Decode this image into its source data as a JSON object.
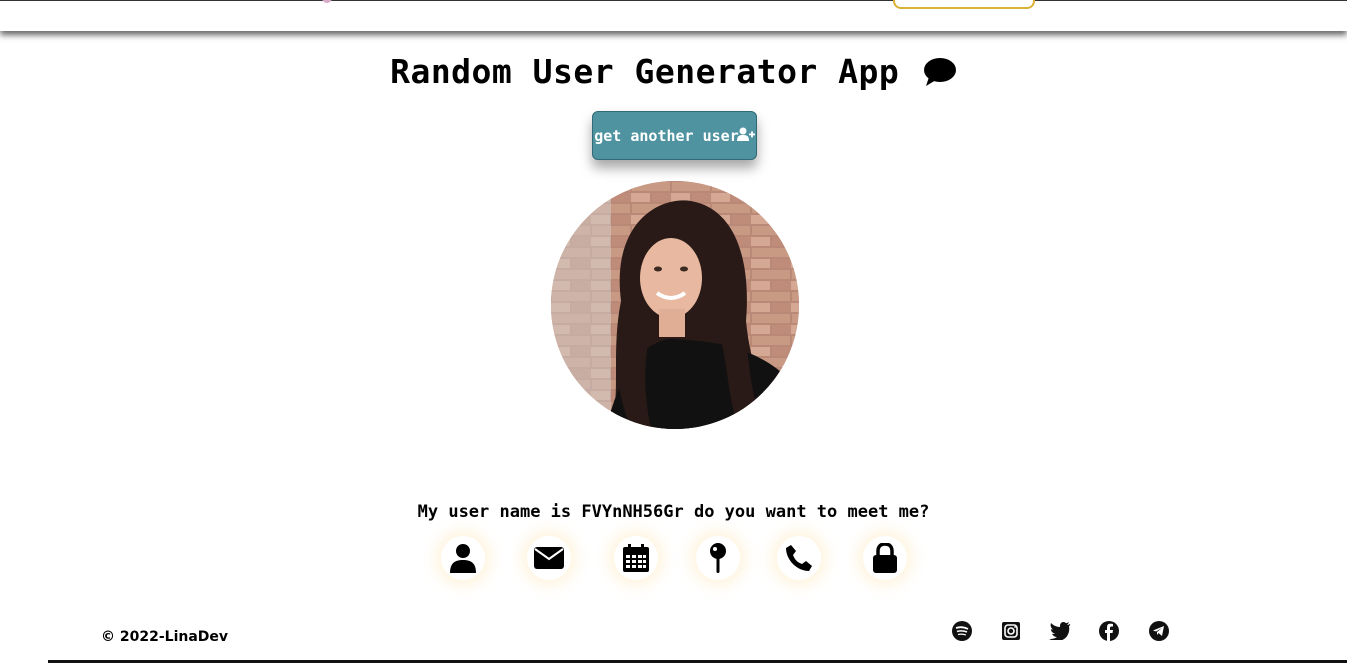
{
  "header": {
    "title": "Random User Generator App",
    "title_icon": "comment-icon"
  },
  "actions": {
    "get_user_label": "get another user",
    "get_user_icon": "user-plus-icon",
    "button_color": "#4f93a1"
  },
  "profile": {
    "avatar_icon": "user-photo",
    "intro_text": "My user name is FVYnNH56Gr do you want to meet me?"
  },
  "info_icons": [
    "user-icon",
    "envelope-icon",
    "calendar-icon",
    "map-pin-icon",
    "phone-icon",
    "lock-icon"
  ],
  "footer": {
    "copyright": "© 2022-LinaDev",
    "social_icons": [
      "spotify-icon",
      "instagram-icon",
      "twitter-icon",
      "facebook-icon",
      "telegram-icon"
    ]
  }
}
